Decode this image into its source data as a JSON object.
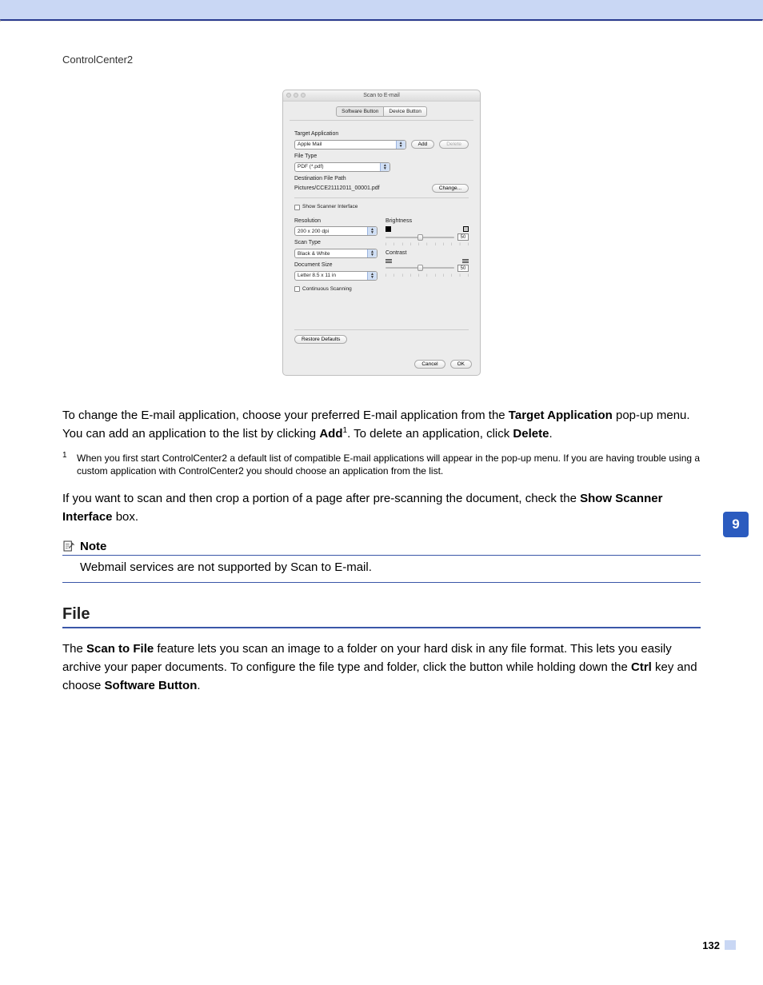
{
  "header": {
    "title": "ControlCenter2"
  },
  "section_tab": "9",
  "page_number": "132",
  "screenshot": {
    "window_title": "Scan to E-mail",
    "tabs": {
      "software": "Software Button",
      "device": "Device Button"
    },
    "target_app": {
      "label": "Target Application",
      "value": "Apple Mail",
      "add": "Add",
      "delete": "Delete"
    },
    "file_type": {
      "label": "File Type",
      "value": "PDF (*.pdf)"
    },
    "dest_path": {
      "label": "Destination File Path",
      "value": "Pictures/CCE21112011_00001.pdf",
      "change": "Change..."
    },
    "show_scanner": "Show Scanner Interface",
    "resolution": {
      "label": "Resolution",
      "value": "200 x 200 dpi"
    },
    "scan_type": {
      "label": "Scan Type",
      "value": "Black & White"
    },
    "doc_size": {
      "label": "Document Size",
      "value": "Letter 8.5 x 11 in"
    },
    "continuous": "Continuous Scanning",
    "brightness": {
      "label": "Brightness",
      "value": "50"
    },
    "contrast": {
      "label": "Contrast",
      "value": "50"
    },
    "restore": "Restore Defaults",
    "cancel": "Cancel",
    "ok": "OK"
  },
  "para1_a": "To change the E-mail application, choose your preferred E-mail application from the ",
  "para1_b": "Target Application",
  "para1_c": " pop-up menu. You can add an application to the list by clicking ",
  "para1_d": "Add",
  "para1_sup": "1",
  "para1_e": ". To delete an application, click ",
  "para1_f": "Delete",
  "para1_g": ".",
  "footnote_num": "1",
  "footnote_text": "When you first start ControlCenter2 a default list of compatible E-mail applications will appear in the pop-up menu. If you are having trouble using a custom application with ControlCenter2 you should choose an application from the list.",
  "para2_a": "If you want to scan and then crop a portion of a page after pre-scanning the document, check the ",
  "para2_b": "Show Scanner Interface",
  "para2_c": " box.",
  "note_label": "Note",
  "note_body": "Webmail services are not supported by Scan to E-mail.",
  "file_heading": "File",
  "para3_a": "The ",
  "para3_b": "Scan to File",
  "para3_c": " feature lets you scan an image to a folder on your hard disk in any file format. This lets you easily archive your paper documents. To configure the file type and folder, click the button while holding down the ",
  "para3_d": "Ctrl",
  "para3_e": " key and choose ",
  "para3_f": "Software Button",
  "para3_g": "."
}
